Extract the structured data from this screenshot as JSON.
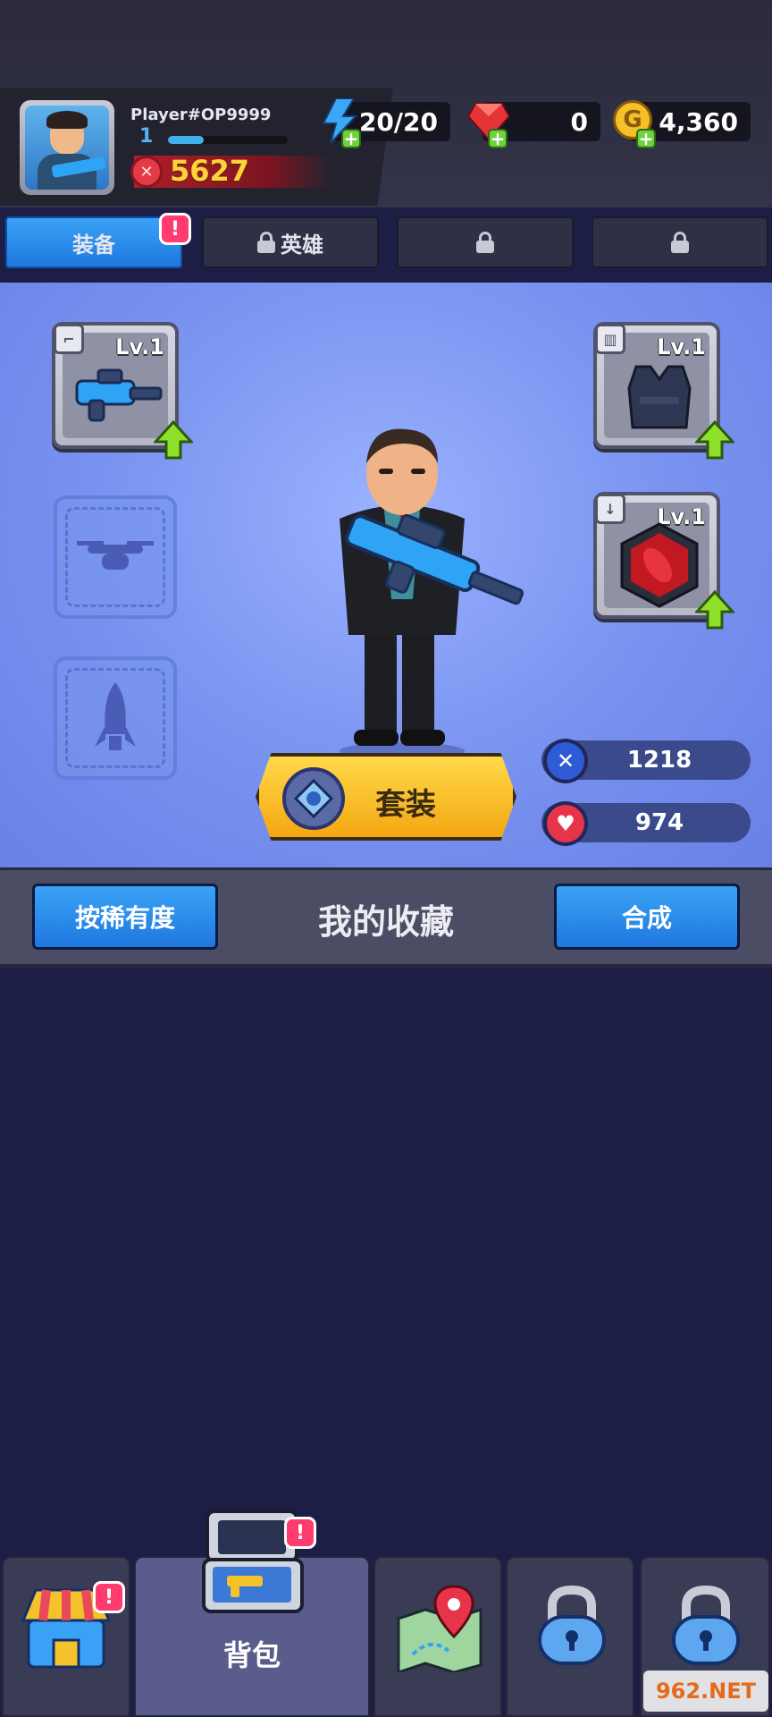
{
  "header": {
    "player_name": "Player#OP9999",
    "level": "1",
    "xp_fraction": 0.3,
    "power": "5627",
    "resources": {
      "energy": "20/20",
      "gems": "0",
      "gold": "4,360"
    }
  },
  "tabs": [
    {
      "label": "装备",
      "active": true,
      "locked": false
    },
    {
      "label": "英雄",
      "active": false,
      "locked": true
    },
    {
      "label": "",
      "active": false,
      "locked": true
    },
    {
      "label": "",
      "active": false,
      "locked": true
    }
  ],
  "badges": {
    "alert": "!"
  },
  "equipment": {
    "weapon_level": "Lv.1",
    "armor_level": "Lv.1",
    "bomb_level": "Lv.1"
  },
  "set_button": {
    "label": "套装"
  },
  "stats": {
    "attack": "1218",
    "health": "974"
  },
  "collection": {
    "sort_button": "按稀有度",
    "title": "我的收藏",
    "merge_button": "合成"
  },
  "bottom_nav": {
    "backpack_label": "背包"
  },
  "watermark": "962.NET",
  "colors": {
    "tab_active": "#1f78df",
    "equip_bg": "#7a94f0",
    "button_yellow": "#f4a712",
    "page_bg": "#1d1e45"
  }
}
